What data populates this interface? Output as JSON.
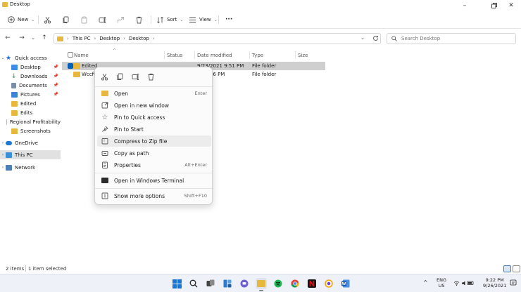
{
  "window": {
    "title": "Desktop"
  },
  "toolbar": {
    "new_label": "New",
    "sort_label": "Sort",
    "view_label": "View",
    "more_label": "···"
  },
  "address": {
    "crumbs": [
      "This PC",
      "Desktop",
      "Desktop"
    ]
  },
  "search": {
    "placeholder": "Search Desktop"
  },
  "sidebar": {
    "items": [
      {
        "label": "Quick access"
      },
      {
        "label": "Desktop"
      },
      {
        "label": "Downloads"
      },
      {
        "label": "Documents"
      },
      {
        "label": "Pictures"
      },
      {
        "label": "Edited"
      },
      {
        "label": "Edits"
      },
      {
        "label": "Regional Profitability"
      },
      {
        "label": "Screenshots"
      },
      {
        "label": "OneDrive"
      },
      {
        "label": "This PC"
      },
      {
        "label": "Network"
      }
    ]
  },
  "columns": {
    "name": "Name",
    "status": "Status",
    "date": "Date modified",
    "type": "Type",
    "size": "Size"
  },
  "files": [
    {
      "name": "Edited",
      "date": "9/23/2021 9:51 PM",
      "type": "File folder"
    },
    {
      "name": "Wccftech",
      "date": "21 8:56 PM",
      "type": "File folder"
    }
  ],
  "context_menu": {
    "items": [
      {
        "label": "Open",
        "shortcut": "Enter"
      },
      {
        "label": "Open in new window",
        "shortcut": ""
      },
      {
        "label": "Pin to Quick access",
        "shortcut": ""
      },
      {
        "label": "Pin to Start",
        "shortcut": ""
      },
      {
        "label": "Compress to Zip file",
        "shortcut": ""
      },
      {
        "label": "Copy as path",
        "shortcut": ""
      },
      {
        "label": "Properties",
        "shortcut": "Alt+Enter"
      },
      {
        "label": "Open in Windows Terminal",
        "shortcut": ""
      },
      {
        "label": "Show more options",
        "shortcut": "Shift+F10"
      }
    ]
  },
  "statusbar": {
    "count": "2 items",
    "selected": "1 item selected"
  },
  "tray": {
    "lang1": "ENG",
    "lang2": "US",
    "time": "9:22 PM",
    "date": "9/26/2021"
  },
  "colors": {
    "accent": "#005fb8",
    "folder": "#e8b73d",
    "selection": "#cfcfcf"
  }
}
